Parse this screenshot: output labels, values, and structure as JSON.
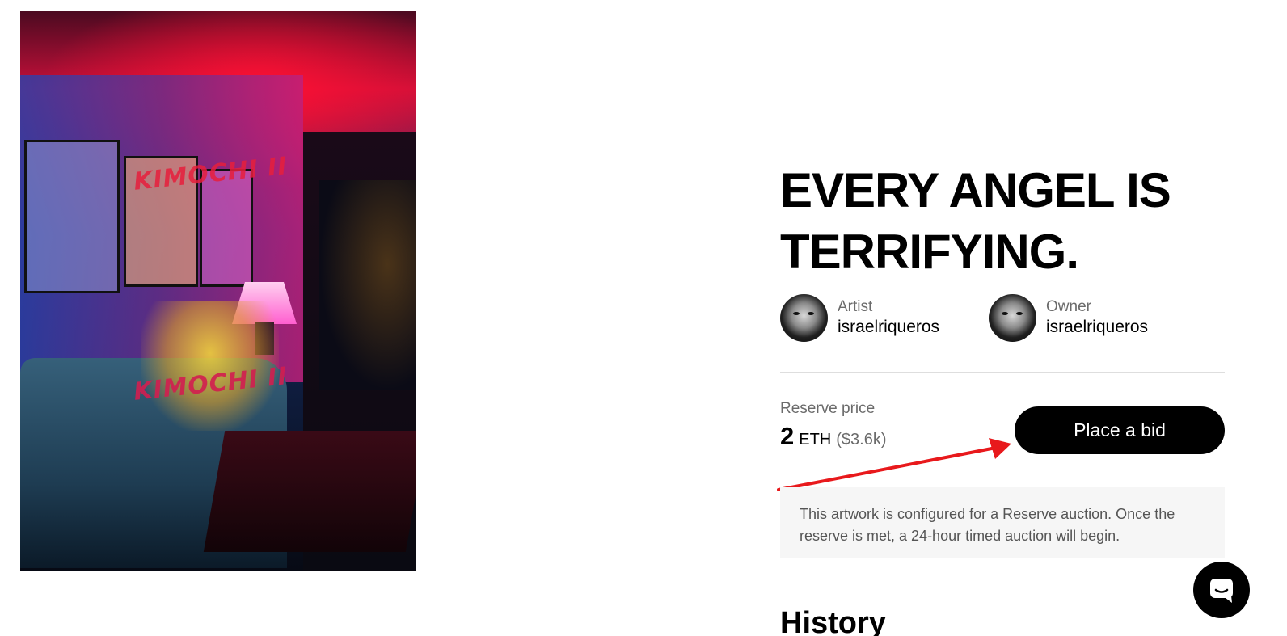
{
  "artwork": {
    "overlay_text_top": "KIMOCHI II",
    "overlay_text_bottom": "KIMOCHI II"
  },
  "title": "EVERY ANGEL IS TERRIFYING.",
  "artist": {
    "role": "Artist",
    "name": "israelriqueros"
  },
  "owner": {
    "role": "Owner",
    "name": "israelriqueros"
  },
  "reserve": {
    "label": "Reserve price",
    "amount": "2",
    "unit": "ETH",
    "usd": "($3.6k)"
  },
  "bid_button_label": "Place a bid",
  "info_text": "This artwork is configured for a Reserve auction. Once the reserve is met, a 24-hour timed auction will begin.",
  "history_heading": "History",
  "colors": {
    "button_bg": "#000000",
    "annotation_arrow": "#e8191c",
    "info_bg": "#f6f6f6"
  },
  "icons": {
    "chat": "chat-bubble-icon",
    "annotation": "red-arrow-annotation"
  }
}
